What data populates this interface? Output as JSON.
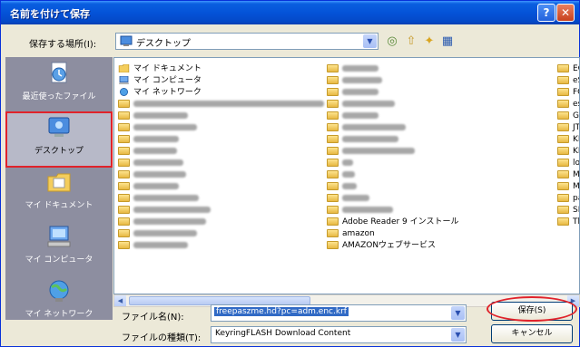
{
  "window": {
    "title": "名前を付けて保存"
  },
  "location": {
    "label": "保存する場所(I):",
    "value": "デスクトップ"
  },
  "places": [
    {
      "label": "最近使ったファイル",
      "icon": "recent-documents-icon"
    },
    {
      "label": "デスクトップ",
      "icon": "desktop-icon",
      "selected": true
    },
    {
      "label": "マイ ドキュメント",
      "icon": "my-documents-icon"
    },
    {
      "label": "マイ コンピュータ",
      "icon": "my-computer-icon"
    },
    {
      "label": "マイ ネットワーク",
      "icon": "my-network-icon"
    }
  ],
  "files": {
    "col1": [
      {
        "label": "マイ ドキュメント",
        "icon": "my-documents-icon"
      },
      {
        "label": "マイ コンピュータ",
        "icon": "my-computer-icon"
      },
      {
        "label": "マイ ネットワーク",
        "icon": "my-network-icon"
      }
    ],
    "col2_visible": [
      {
        "label": "Adobe Reader 9 インストール",
        "row": 13
      },
      {
        "label": "amazon",
        "row": 14
      },
      {
        "label": "AMAZONウェブサービス",
        "row": 15
      }
    ],
    "col3": [
      "EC",
      "eS",
      "FO",
      "es",
      "Gu",
      "JT",
      "KE",
      "KF",
      "los",
      "Mi",
      "Mi",
      "pa",
      "SE",
      "Thi"
    ]
  },
  "filename": {
    "label": "ファイル名(N):",
    "value": "freepaszme.hd?pc=adm.enc.krf"
  },
  "filetype": {
    "label": "ファイルの種類(T):",
    "value": "KeyringFLASH Download Content"
  },
  "buttons": {
    "save": "保存(S)",
    "cancel": "キャンセル"
  },
  "colors": {
    "titlebar": "#0453d8",
    "highlight": "#316ac5",
    "annotation": "#e0232b"
  }
}
